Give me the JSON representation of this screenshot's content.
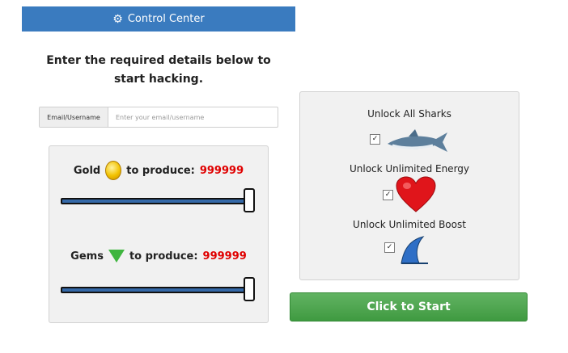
{
  "header": {
    "title": "Control Center",
    "icon": "gear-icon"
  },
  "intro": {
    "text": "Enter the required details below to start hacking."
  },
  "email": {
    "label": "Email/Username",
    "placeholder": "Enter your email/username",
    "value": ""
  },
  "resources": {
    "gold": {
      "label": "Gold",
      "suffix": "to produce:",
      "value": "999999",
      "slider_level": 1.0,
      "icon": "gold-coin-icon"
    },
    "gems": {
      "label": "Gems",
      "suffix": "to produce:",
      "value": "999999",
      "slider_level": 1.0,
      "icon": "gem-icon"
    }
  },
  "unlocks": [
    {
      "label": "Unlock All Sharks",
      "checked": true,
      "icon": "shark-icon"
    },
    {
      "label": "Unlock Unlimited Energy",
      "checked": true,
      "icon": "heart-icon"
    },
    {
      "label": "Unlock Unlimited Boost",
      "checked": true,
      "icon": "fin-icon"
    }
  ],
  "start_button": {
    "label": "Click to Start",
    "color": "#4aa64c"
  },
  "colors": {
    "header": "#3a7bbf",
    "value": "#e00000",
    "slider": "#3569a8"
  }
}
